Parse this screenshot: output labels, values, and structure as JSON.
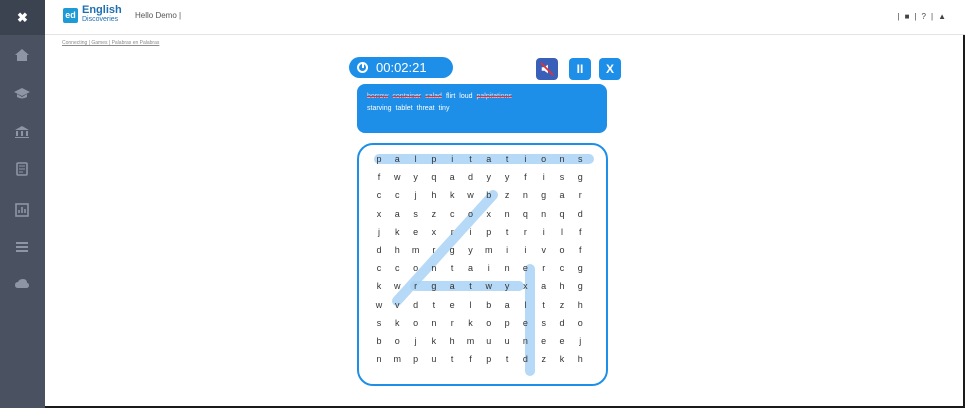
{
  "app": {
    "logo_badge": "ed",
    "logo_title": "English",
    "logo_subtitle": "Discoveries",
    "greeting": "Hello Demo |",
    "close_label": "✖",
    "top_right": [
      "|",
      "■",
      "|",
      "?",
      "|",
      "▲"
    ]
  },
  "breadcrumb": {
    "text": "Connecting | Games | Palabras en Palabras"
  },
  "sidebar": {
    "items": [
      "home-icon",
      "graduation-icon",
      "bank-icon",
      "notebook-icon",
      "chart-icon",
      "list-icon",
      "cloud-icon"
    ]
  },
  "timer": {
    "value": "00:02:21"
  },
  "controls": {
    "sound": "🔇",
    "pause": "II",
    "exit": "X"
  },
  "words": [
    {
      "text": "borrow",
      "found": true
    },
    {
      "text": "container",
      "found": true
    },
    {
      "text": "salad",
      "found": true
    },
    {
      "text": "flirt",
      "found": false
    },
    {
      "text": "loud",
      "found": false
    },
    {
      "text": "palpitations",
      "found": true
    },
    {
      "text": "starving",
      "found": false
    },
    {
      "text": "tablet",
      "found": false
    },
    {
      "text": "threat",
      "found": false
    },
    {
      "text": "tiny",
      "found": false
    }
  ],
  "grid": [
    [
      "p",
      "a",
      "l",
      "p",
      "i",
      "t",
      "a",
      "t",
      "i",
      "o",
      "n",
      "s"
    ],
    [
      "f",
      "w",
      "y",
      "q",
      "a",
      "d",
      "y",
      "y",
      "f",
      "i",
      "s",
      "g"
    ],
    [
      "c",
      "c",
      "j",
      "h",
      "k",
      "w",
      "b",
      "z",
      "n",
      "g",
      "a",
      "r"
    ],
    [
      "x",
      "a",
      "s",
      "z",
      "c",
      "o",
      "x",
      "n",
      "q",
      "n",
      "q",
      "d"
    ],
    [
      "j",
      "k",
      "e",
      "x",
      "r",
      "i",
      "p",
      "t",
      "r",
      "i",
      "l",
      "f"
    ],
    [
      "d",
      "h",
      "m",
      "r",
      "g",
      "y",
      "m",
      "i",
      "i",
      "v",
      "o",
      "f"
    ],
    [
      "c",
      "c",
      "o",
      "n",
      "t",
      "a",
      "i",
      "n",
      "e",
      "r",
      "c",
      "g"
    ],
    [
      "k",
      "w",
      "r",
      "g",
      "a",
      "t",
      "w",
      "y",
      "x",
      "a",
      "h",
      "g"
    ],
    [
      "w",
      "v",
      "d",
      "t",
      "e",
      "l",
      "b",
      "a",
      "l",
      "t",
      "z",
      "h"
    ],
    [
      "s",
      "k",
      "o",
      "n",
      "r",
      "k",
      "o",
      "p",
      "e",
      "s",
      "d",
      "o"
    ],
    [
      "b",
      "o",
      "j",
      "k",
      "h",
      "m",
      "u",
      "u",
      "n",
      "e",
      "e",
      "j"
    ],
    [
      "n",
      "m",
      "p",
      "u",
      "t",
      "f",
      "p",
      "t",
      "d",
      "z",
      "k",
      "h"
    ]
  ],
  "colors": {
    "accent": "#1e8fe8",
    "sidebar": "#4a5261",
    "highlight": "#a9d3f5"
  }
}
